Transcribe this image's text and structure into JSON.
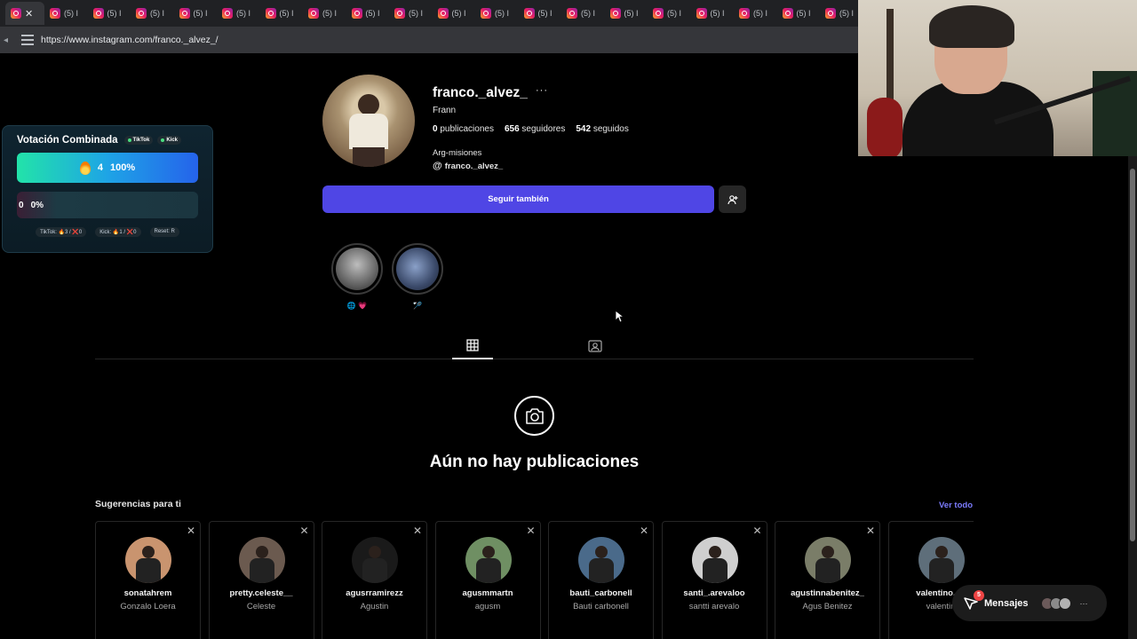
{
  "browser": {
    "tabs": [
      {
        "label": "",
        "active": true
      },
      {
        "label": "(5) I"
      },
      {
        "label": "(5) I"
      },
      {
        "label": "(5) I"
      },
      {
        "label": "(5) I"
      },
      {
        "label": "(5) I"
      },
      {
        "label": "(5) I"
      },
      {
        "label": "(5) I"
      },
      {
        "label": "(5) I"
      },
      {
        "label": "(5) I"
      },
      {
        "label": "(5) I"
      },
      {
        "label": "(5) I"
      },
      {
        "label": "(5) I"
      },
      {
        "label": "(5) I"
      },
      {
        "label": "(5) I"
      },
      {
        "label": "(5) I"
      },
      {
        "label": "(5) I"
      },
      {
        "label": "(5) I"
      },
      {
        "label": "(5) I"
      },
      {
        "label": "(5) I"
      }
    ],
    "url": "https://www.instagram.com/franco._alvez_/"
  },
  "vote_widget": {
    "title": "Votación Combinada",
    "badge_tiktok": "TikTok",
    "badge_kick": "Kick",
    "option1_count": "4",
    "option1_percent": "100%",
    "option2_count": "0",
    "option2_percent": "0%",
    "footer_tiktok": "TikTok: 🔥3 / ❌0",
    "footer_kick": "Kick: 🔥1 / ❌0",
    "footer_reset": "Reset: R"
  },
  "profile": {
    "username": "franco._alvez_",
    "more_label": "···",
    "full_name": "Frann",
    "posts_count": "0",
    "posts_label": "publicaciones",
    "followers_count": "656",
    "followers_label": "seguidores",
    "following_count": "542",
    "following_label": "seguidos",
    "bio": "Arg-misiones",
    "threads_handle": "franco._alvez_",
    "follow_button": "Seguir también"
  },
  "highlights": [
    {
      "caption": "🌐 💗"
    },
    {
      "caption": "🏸"
    }
  ],
  "empty_state": {
    "title": "Aún no hay publicaciones"
  },
  "suggestions": {
    "title": "Sugerencias para ti",
    "see_all": "Ver todo",
    "cards": [
      {
        "username": "sonatahrem",
        "name": "Gonzalo Loera",
        "color": "#c9946f"
      },
      {
        "username": "pretty.celeste__",
        "name": "Celeste",
        "color": "#6b5a4f"
      },
      {
        "username": "agusrramirezz",
        "name": "Agustin",
        "color": "#1a1a1a"
      },
      {
        "username": "agusmmartn",
        "name": "agusm",
        "color": "#6f8f63"
      },
      {
        "username": "bauti_carbonell",
        "name": "Bauti carbonell",
        "color": "#4a6a8a"
      },
      {
        "username": "santi_.arevaloo",
        "name": "santti arevalo",
        "color": "#cfcfcf"
      },
      {
        "username": "agustinnabenitez_",
        "name": "Agus Benitez",
        "color": "#7a7d68"
      },
      {
        "username": "valentino._b",
        "name": "valentin",
        "color": "#5e6e7a"
      }
    ]
  },
  "messages": {
    "label": "Mensajes",
    "badge": "5",
    "more": "···"
  },
  "colors": {
    "primary_button": "#4f46e5",
    "link": "#7c7cff",
    "background": "#000000"
  }
}
